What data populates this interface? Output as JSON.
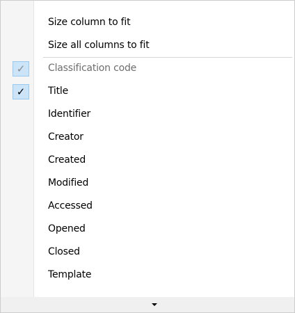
{
  "menu": {
    "top_items": [
      {
        "label": "Size column to fit"
      },
      {
        "label": "Size all columns to fit"
      }
    ],
    "column_items": [
      {
        "label": "Classification code",
        "checked": true,
        "disabled": true
      },
      {
        "label": "Title",
        "checked": true,
        "disabled": false
      },
      {
        "label": "Identifier",
        "checked": false,
        "disabled": false
      },
      {
        "label": "Creator",
        "checked": false,
        "disabled": false
      },
      {
        "label": "Created",
        "checked": false,
        "disabled": false
      },
      {
        "label": "Modified",
        "checked": false,
        "disabled": false
      },
      {
        "label": "Accessed",
        "checked": false,
        "disabled": false
      },
      {
        "label": "Opened",
        "checked": false,
        "disabled": false
      },
      {
        "label": "Closed",
        "checked": false,
        "disabled": false
      },
      {
        "label": "Template",
        "checked": false,
        "disabled": false
      }
    ],
    "check_glyph": "✓",
    "scroll_down_icon": "triangle-down-icon",
    "colors": {
      "check_background": "#cce4f7",
      "check_border": "#99c9ef",
      "disabled_text": "#6d6d6d"
    }
  }
}
